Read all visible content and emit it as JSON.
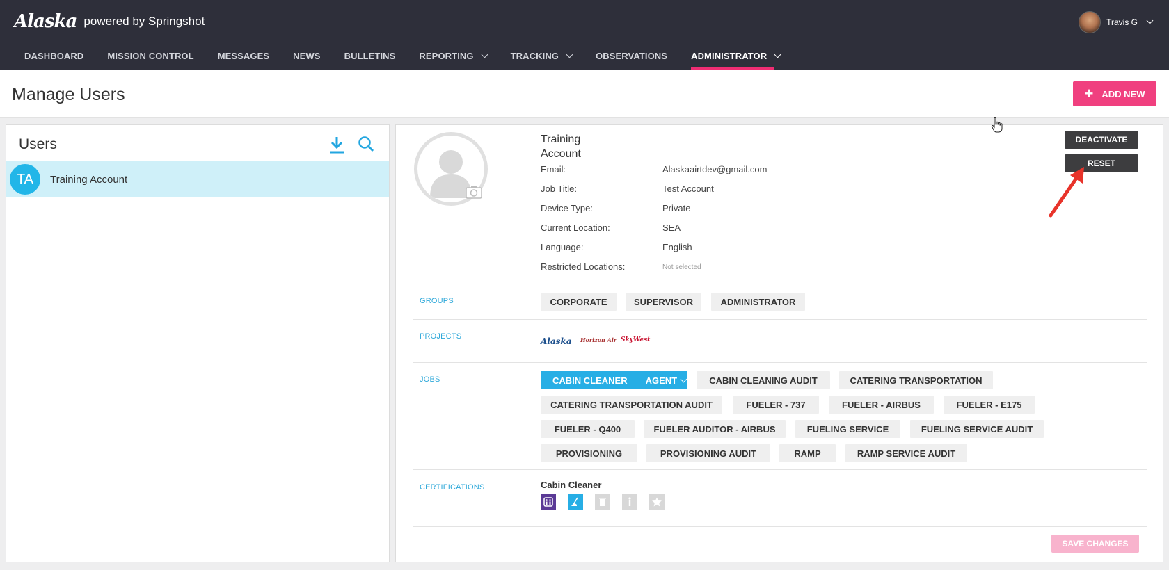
{
  "brand": {
    "logo": "Alaska",
    "subtitle": "powered by Springshot"
  },
  "user_menu": {
    "name": "Travis G"
  },
  "nav": {
    "items": [
      {
        "label": "DASHBOARD",
        "dropdown": false,
        "active": false
      },
      {
        "label": "MISSION CONTROL",
        "dropdown": false,
        "active": false
      },
      {
        "label": "MESSAGES",
        "dropdown": false,
        "active": false
      },
      {
        "label": "NEWS",
        "dropdown": false,
        "active": false
      },
      {
        "label": "BULLETINS",
        "dropdown": false,
        "active": false
      },
      {
        "label": "REPORTING",
        "dropdown": true,
        "active": false
      },
      {
        "label": "TRACKING",
        "dropdown": true,
        "active": false
      },
      {
        "label": "OBSERVATIONS",
        "dropdown": false,
        "active": false
      },
      {
        "label": "ADMINISTRATOR",
        "dropdown": true,
        "active": true
      }
    ]
  },
  "header": {
    "title": "Manage Users",
    "add_label": "ADD NEW"
  },
  "users_panel": {
    "title": "Users",
    "icons": [
      "download-icon",
      "search-icon"
    ],
    "users": [
      {
        "initials": "TA",
        "name": "Training Account",
        "selected": true
      }
    ]
  },
  "detail": {
    "name": "Training Account",
    "fields": [
      {
        "label": "Email:",
        "value": "Alaskaairtdev@gmail.com"
      },
      {
        "label": "Job Title:",
        "value": "Test Account"
      },
      {
        "label": "Device Type:",
        "value": "Private"
      },
      {
        "label": "Current Location:",
        "value": "SEA"
      },
      {
        "label": "Language:",
        "value": "English"
      },
      {
        "label": "Restricted Locations:",
        "value": "Not selected"
      }
    ],
    "deactivate_label": "DEACTIVATE",
    "reset_label": "RESET",
    "groups_label": "GROUPS",
    "groups": [
      "CORPORATE",
      "SUPERVISOR",
      "ADMINISTRATOR"
    ],
    "projects_label": "PROJECTS",
    "projects": [
      "Alaska",
      "Horizon Air",
      "SkyWest"
    ],
    "jobs_label": "JOBS",
    "selected_job": {
      "name": "CABIN CLEANER",
      "role": "AGENT"
    },
    "jobs": [
      "CABIN CLEANING AUDIT",
      "CATERING TRANSPORTATION",
      "CATERING TRANSPORTATION AUDIT",
      "FUELER - 737",
      "FUELER - AIRBUS",
      "FUELER - E175",
      "FUELER - Q400",
      "FUELER AUDITOR - AIRBUS",
      "FUELING SERVICE",
      "FUELING SERVICE AUDIT",
      "PROVISIONING",
      "PROVISIONING AUDIT",
      "RAMP",
      "RAMP SERVICE AUDIT"
    ],
    "certifications_label": "CERTIFICATIONS",
    "certification_title": "Cabin Cleaner",
    "cert_icons": [
      {
        "name": "lavatory-icon",
        "color": "#5b3a96"
      },
      {
        "name": "vacuum-icon",
        "color": "#27aee5"
      },
      {
        "name": "trash-icon",
        "color": "#d8d8d8"
      },
      {
        "name": "info-icon",
        "color": "#d8d8d8"
      },
      {
        "name": "star-icon",
        "color": "#d8d8d8"
      }
    ],
    "save_label": "SAVE CHANGES"
  },
  "colors": {
    "accent_pink": "#f0407f",
    "accent_blue": "#27aee5",
    "nav_bg": "#2e2f3a"
  }
}
